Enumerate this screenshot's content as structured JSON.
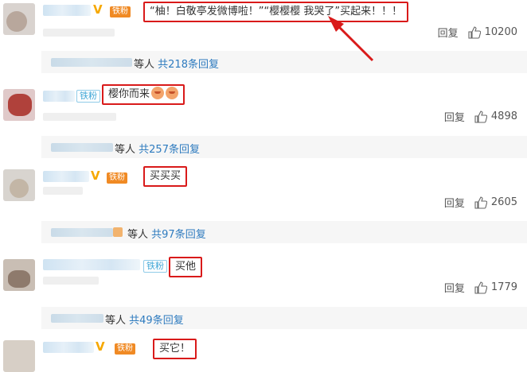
{
  "comments": [
    {
      "highlight_text": "“柚！白敬亭发微博啦！”“樱樱樱 我哭了”买起来！！！",
      "fan_badge": "铁粉",
      "reply_label": "回复",
      "like_count": "10200",
      "replies_suffix": "等人",
      "replies_link": "共218条回复"
    },
    {
      "highlight_text": "樱你而来",
      "fan_badge": "铁粉",
      "reply_label": "回复",
      "like_count": "4898",
      "replies_suffix": "等人",
      "replies_link": "共257条回复"
    },
    {
      "highlight_text": "买买买",
      "fan_badge": "铁粉",
      "reply_label": "回复",
      "like_count": "2605",
      "replies_suffix": "等人",
      "replies_link": "共97条回复"
    },
    {
      "highlight_text": "买他",
      "fan_badge": "铁粉",
      "reply_label": "回复",
      "like_count": "1779",
      "replies_suffix": "等人",
      "replies_link": "共49条回复"
    },
    {
      "highlight_text": "买它！",
      "fan_badge": "铁粉"
    }
  ],
  "colors": {
    "highlight_border": "#d91a1a",
    "link_blue": "#2e7bbf",
    "vip_gold": "#f6a800"
  }
}
